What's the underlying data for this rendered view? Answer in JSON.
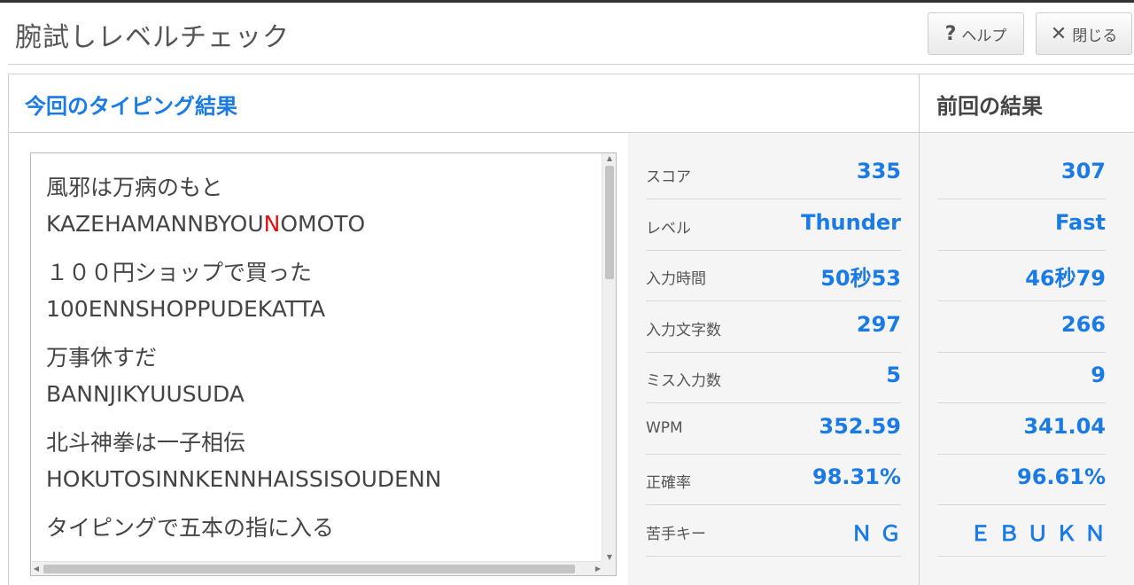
{
  "window": {
    "title": "腕試しレベルチェック",
    "help_label": "ヘルプ",
    "close_label": "閉じる"
  },
  "panel": {
    "current_title": "今回のタイピング結果",
    "previous_title": "前回の結果"
  },
  "typing_log": [
    {
      "japanese": "風邪は万病のもと",
      "romaji_before": "KAZEHAMANNBYOU",
      "romaji_error": "N",
      "romaji_after": "OMOTO"
    },
    {
      "japanese": "１００円ショップで買った",
      "romaji_before": "100ENNSHOPPUDEKATTA",
      "romaji_error": "",
      "romaji_after": ""
    },
    {
      "japanese": "万事休すだ",
      "romaji_before": "BANNJIKYUUSUDA",
      "romaji_error": "",
      "romaji_after": ""
    },
    {
      "japanese": "北斗神拳は一子相伝",
      "romaji_before": "HOKUTOSINNKENNHAISSISOUDENN",
      "romaji_error": "",
      "romaji_after": ""
    },
    {
      "japanese": "タイピングで五本の指に入る",
      "romaji_before": "",
      "romaji_error": "",
      "romaji_after": ""
    }
  ],
  "stats": [
    {
      "label": "スコア",
      "current": "335",
      "previous": "307"
    },
    {
      "label": "レベル",
      "current": "Thunder",
      "previous": "Fast"
    },
    {
      "label": "入力時間",
      "current": "50秒53",
      "previous": "46秒79"
    },
    {
      "label": "入力文字数",
      "current": "297",
      "previous": "266"
    },
    {
      "label": "ミス入力数",
      "current": "5",
      "previous": "9"
    },
    {
      "label": "WPM",
      "current": "352.59",
      "previous": "341.04"
    },
    {
      "label": "正確率",
      "current": "98.31%",
      "previous": "96.61%"
    },
    {
      "label": "苦手キー",
      "current": "Ｎ Ｇ",
      "previous": "Ｅ Ｂ Ｕ Ｋ Ｎ"
    }
  ],
  "colors": {
    "accent": "#1a7be6",
    "error": "#e01010"
  }
}
